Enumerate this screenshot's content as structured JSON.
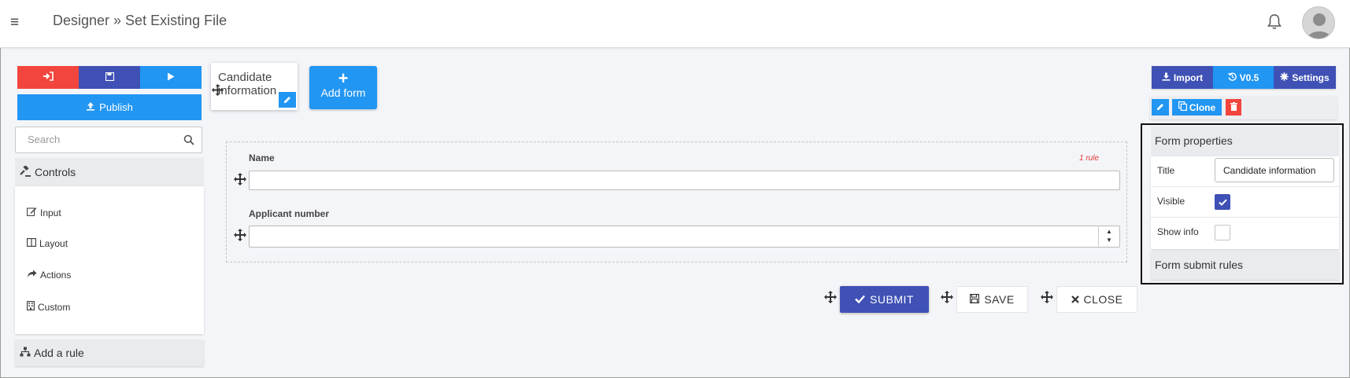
{
  "header": {
    "breadcrumb": "Designer » Set Existing File"
  },
  "toolbar_left": {
    "publish_label": "Publish"
  },
  "search": {
    "placeholder": "Search"
  },
  "controls": {
    "title": "Controls",
    "items": [
      {
        "label": "Input",
        "icon": "edit-icon"
      },
      {
        "label": "Layout",
        "icon": "columns-icon"
      },
      {
        "label": "Actions",
        "icon": "share-icon"
      },
      {
        "label": "Custom",
        "icon": "building-icon"
      }
    ]
  },
  "rules": {
    "title": "Add a rule"
  },
  "form_tab": {
    "title": "Candidate information"
  },
  "add_form": {
    "label": "Add form"
  },
  "form": {
    "fields": [
      {
        "label": "Name",
        "rule_count": "1 rule"
      },
      {
        "label": "Applicant number"
      }
    ],
    "actions": {
      "submit": "SUBMIT",
      "save": "SAVE",
      "close": "CLOSE"
    }
  },
  "toolbar_right": {
    "import": "Import",
    "version": "V0.5",
    "settings": "Settings",
    "clone": "Clone"
  },
  "form_properties": {
    "title": "Form properties",
    "rows": {
      "title_label": "Title",
      "title_value": "Candidate information",
      "visible_label": "Visible",
      "visible_checked": true,
      "show_info_label": "Show info",
      "show_info_checked": false
    },
    "submit_rules": "Form submit rules"
  },
  "colors": {
    "red": "#f2453d",
    "indigo": "#3f51b5",
    "blue": "#2196f3"
  }
}
